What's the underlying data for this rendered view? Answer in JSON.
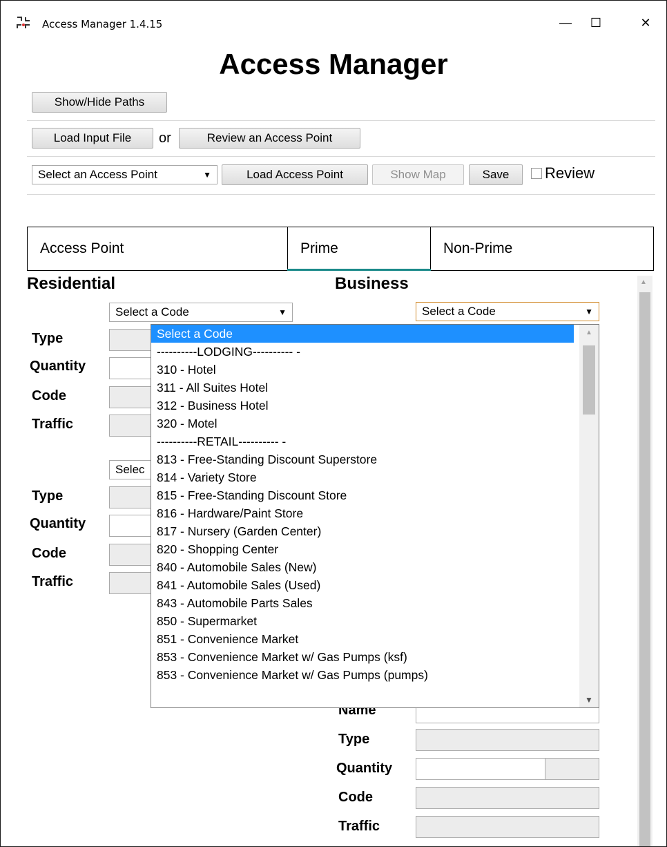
{
  "window": {
    "title": "Access Manager 1.4.15",
    "controls": {
      "minimize": "—",
      "maximize": "☐",
      "close": "✕"
    }
  },
  "app": {
    "heading": "Access Manager"
  },
  "toolbar": {
    "show_hide_paths": "Show/Hide Paths",
    "load_input_file": "Load Input File",
    "or_text": "or",
    "review_access_point": "Review an Access Point",
    "select_access_point": "Select an Access Point",
    "load_access_point": "Load Access Point",
    "show_map": "Show Map",
    "save": "Save",
    "review_label": "Review"
  },
  "tabs": [
    {
      "label": "Access Point"
    },
    {
      "label": "Prime"
    },
    {
      "label": "Non-Prime"
    }
  ],
  "residential": {
    "title": "Residential",
    "select_code": "Select a Code",
    "select_code_2": "Selec",
    "labels": {
      "type": "Type",
      "quantity": "Quantity",
      "code": "Code",
      "traffic": "Traffic"
    }
  },
  "business": {
    "title": "Business",
    "select_code": "Select a Code",
    "labels": {
      "name": "Name",
      "type": "Type",
      "quantity": "Quantity",
      "code": "Code",
      "traffic": "Traffic"
    }
  },
  "dropdown": {
    "items": [
      "Select a Code",
      "----------LODGING---------- -",
      "310 - Hotel",
      "311 - All Suites Hotel",
      "312 - Business Hotel",
      "320 - Motel",
      "----------RETAIL---------- -",
      "813 - Free-Standing Discount Superstore",
      "814 - Variety Store",
      "815 - Free-Standing Discount Store",
      "816 - Hardware/Paint Store",
      "817 - Nursery (Garden Center)",
      "820 - Shopping Center",
      "840 - Automobile Sales (New)",
      "841 - Automobile Sales (Used)",
      "843 - Automobile Parts Sales",
      "850 - Supermarket",
      "851 - Convenience Market",
      "853 - Convenience Market w/ Gas Pumps (ksf)",
      "853 - Convenience Market w/ Gas Pumps (pumps)"
    ],
    "selected_index": 0
  }
}
